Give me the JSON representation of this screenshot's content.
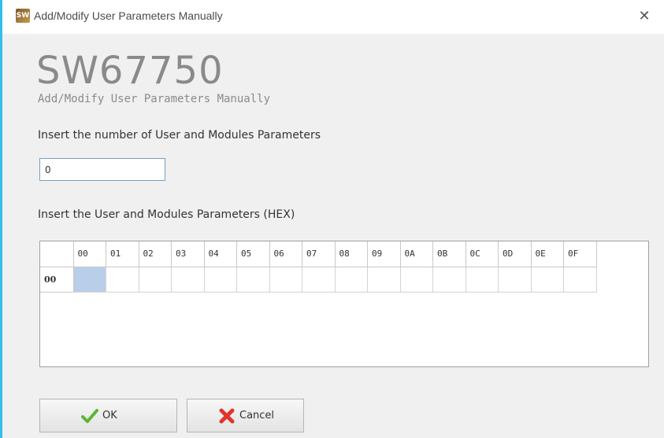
{
  "window": {
    "title": "Add/Modify User Parameters Manually",
    "close_glyph": "✕",
    "icon": "app-icon",
    "accent_color": "#33bfe8"
  },
  "header": {
    "product": "SW67750",
    "subtitle": "Add/Modify User Parameters Manually"
  },
  "count_section": {
    "label": "Insert the number of User and Modules Parameters",
    "value": "0"
  },
  "params_section": {
    "label": "Insert the User and Modules Parameters (HEX)",
    "columns": [
      "00",
      "01",
      "02",
      "03",
      "04",
      "05",
      "06",
      "07",
      "08",
      "09",
      "0A",
      "0B",
      "0C",
      "0D",
      "0E",
      "0F"
    ],
    "rows": [
      {
        "label": "00",
        "cells": [
          "",
          "",
          "",
          "",
          "",
          "",
          "",
          "",
          "",
          "",
          "",
          "",
          "",
          "",
          "",
          ""
        ]
      }
    ],
    "selected_cell": {
      "row": 0,
      "col": 0
    }
  },
  "buttons": {
    "ok": {
      "label": "OK",
      "icon": "checkmark-icon"
    },
    "cancel": {
      "label": "Cancel",
      "icon": "red-x-icon"
    }
  }
}
